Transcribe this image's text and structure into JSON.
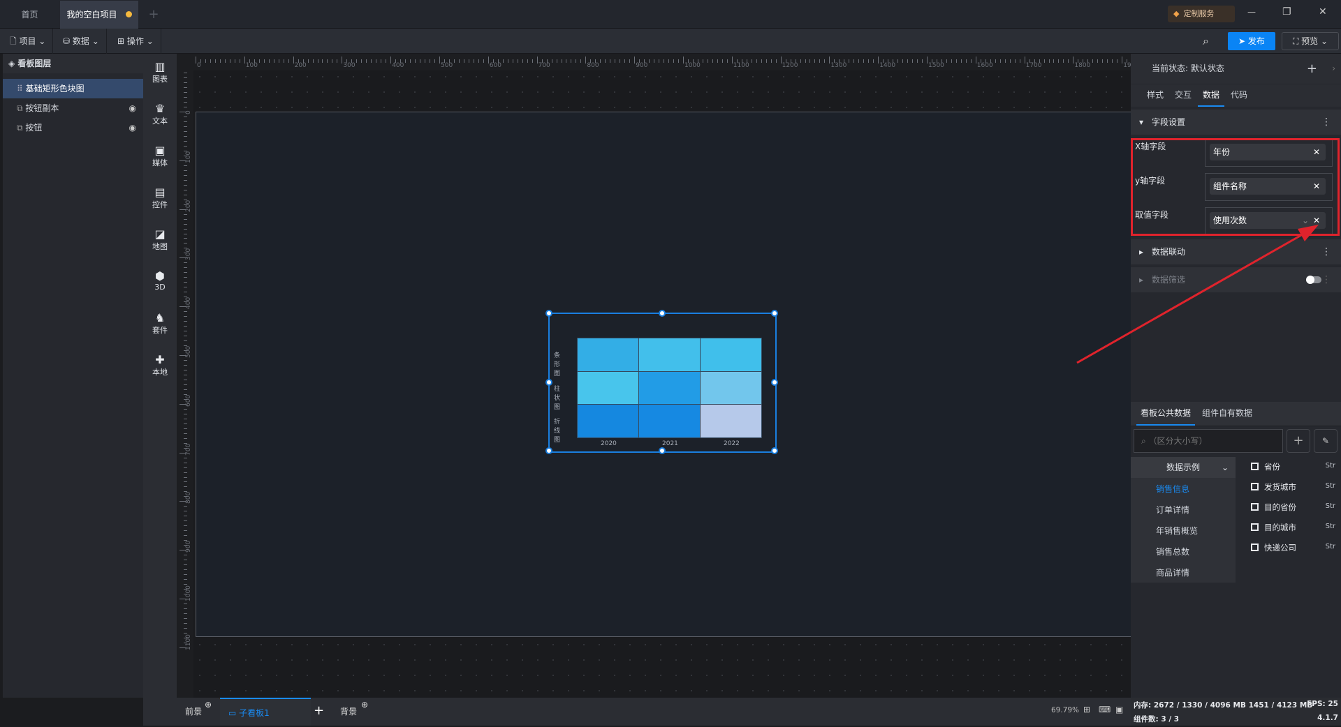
{
  "tabs": {
    "home": "首页",
    "project": "我的空白项目",
    "add": "+"
  },
  "titlebar": {
    "custom_service": "定制服务",
    "minimize": "—",
    "restore": "❐",
    "close": "✕"
  },
  "toolbar": {
    "project": "项目",
    "data": "数据",
    "operate": "操作",
    "publish": "发布",
    "preview": "预览"
  },
  "layers": {
    "title": "看板图层",
    "items": [
      {
        "label": "基础矩形色块图"
      },
      {
        "label": "按钮副本"
      },
      {
        "label": "按钮"
      }
    ]
  },
  "iconbar": [
    {
      "label": "图表",
      "glyph": "▥"
    },
    {
      "label": "文本",
      "glyph": "♛"
    },
    {
      "label": "媒体",
      "glyph": "▣"
    },
    {
      "label": "控件",
      "glyph": "▤"
    },
    {
      "label": "地图",
      "glyph": "◪"
    },
    {
      "label": "3D",
      "glyph": "⬢"
    },
    {
      "label": "套件",
      "glyph": "♞"
    },
    {
      "label": "本地",
      "glyph": "✚"
    }
  ],
  "chart": {
    "y_categories": [
      "条形图",
      "柱状图",
      "折线图"
    ],
    "x_categories": [
      "2020",
      "2021",
      "2022"
    ],
    "cell_colors": [
      [
        "#33aee6",
        "#42bfeb",
        "#40bfeb"
      ],
      [
        "#48c5ec",
        "#229ce6",
        "#72c6ec"
      ],
      [
        "#1588e0",
        "#1689e2",
        "#b6c9ea"
      ]
    ]
  },
  "right": {
    "state_label": "当前状态:",
    "state_value": "默认状态",
    "tabs": [
      "样式",
      "交互",
      "数据",
      "代码"
    ],
    "field_section": "字段设置",
    "fields": [
      {
        "label": "X轴字段",
        "value": "年份"
      },
      {
        "label": "y轴字段",
        "value": "组件名称"
      },
      {
        "label": "取值字段",
        "value": "使用次数"
      }
    ],
    "linkage": "数据联动",
    "filter": "数据筛选",
    "data_tabs": [
      "看板公共数据",
      "组件自有数据"
    ],
    "search_placeholder": "（区分大小写）",
    "dataset_group": "数据示例",
    "datasets": [
      "销售信息",
      "订单详情",
      "年销售概览",
      "销售总数",
      "商品详情"
    ],
    "columns": [
      {
        "name": "省份",
        "type": "Str"
      },
      {
        "name": "发货城市",
        "type": "Str"
      },
      {
        "name": "目的省份",
        "type": "Str"
      },
      {
        "name": "目的城市",
        "type": "Str"
      },
      {
        "name": "快递公司",
        "type": "Str"
      }
    ]
  },
  "bottom": {
    "foreground": "前景",
    "board": "子看板1",
    "add": "+",
    "background": "背景",
    "zoom": "69.79%"
  },
  "status": {
    "memory": "内存:  2672 / 1330 / 4096 MB  1451 / 4123 MB",
    "fps": "FPS:  25",
    "components": "组件数: 3 / 3",
    "version": "4.1.7"
  },
  "colors": {
    "accent": "#1a7fe0",
    "annotation": "#e0232c"
  }
}
